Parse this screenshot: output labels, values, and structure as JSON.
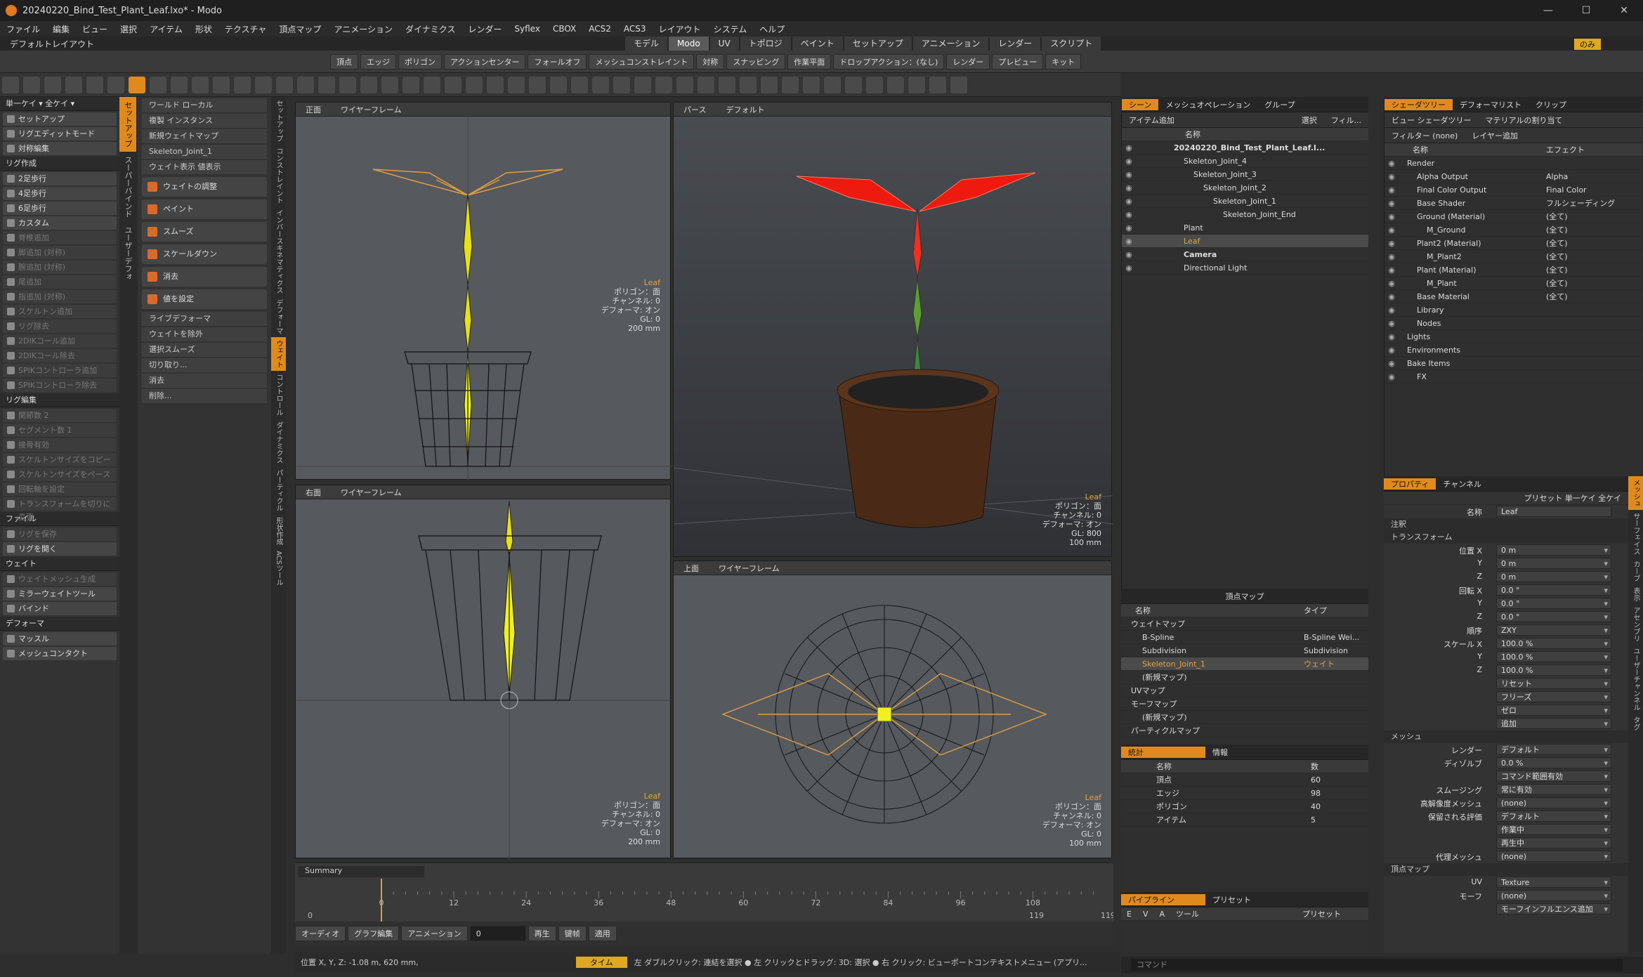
{
  "window": {
    "title": "20240220_Bind_Test_Plant_Leaf.lxo* - Modo"
  },
  "menu": [
    "ファイル",
    "編集",
    "ビュー",
    "選択",
    "アイテム",
    "形状",
    "テクスチャ",
    "頂点マップ",
    "アニメーション",
    "ダイナミクス",
    "レンダー",
    "Syflex",
    "CBOX",
    "ACS2",
    "ACS3",
    "レイアウト",
    "システム",
    "ヘルプ"
  ],
  "layout": {
    "label": "デフォルトレイアウト",
    "tabs": [
      "モデル",
      "Modo",
      "UV",
      "トポロジ",
      "ペイント",
      "セットアップ",
      "アニメーション",
      "レンダー",
      "スクリプト"
    ],
    "active": "Modo",
    "right": "のみ"
  },
  "toolbar": {
    "items": [
      "頂点",
      "エッジ",
      "ポリゴン",
      "アクションセンター",
      "フォールオフ",
      "メッシュコンストレイント",
      "対称",
      "スナッピング",
      "作業平面",
      "ドロップアクション：(なし)",
      "レンダー",
      "プレビュー",
      "キット"
    ]
  },
  "left": {
    "top": "単一ケイ ▾  全ケイ ▾",
    "items": [
      {
        "t": "b",
        "l": "セットアップ"
      },
      {
        "t": "b",
        "l": "リグエディットモード"
      },
      {
        "t": "b",
        "l": "対称編集"
      },
      {
        "t": "h",
        "l": "リグ作成"
      },
      {
        "t": "b",
        "l": "2足歩行"
      },
      {
        "t": "b",
        "l": "4足歩行"
      },
      {
        "t": "b",
        "l": "6足歩行"
      },
      {
        "t": "b",
        "l": "カスタム"
      },
      {
        "t": "d",
        "l": "脊椎追加"
      },
      {
        "t": "d",
        "l": "脚追加 (対称)"
      },
      {
        "t": "d",
        "l": "腕追加 (対称)"
      },
      {
        "t": "d",
        "l": "尾追加"
      },
      {
        "t": "d",
        "l": "指追加 (対称)"
      },
      {
        "t": "d",
        "l": "スケルトン追加"
      },
      {
        "t": "d",
        "l": "リグ除去"
      },
      {
        "t": "d",
        "l": "2DIKコール追加"
      },
      {
        "t": "d",
        "l": "2DIKコール除去"
      },
      {
        "t": "d",
        "l": "SPIKコントローラ追加"
      },
      {
        "t": "d",
        "l": "SPIKコントローラ除去"
      },
      {
        "t": "h",
        "l": "リグ編集"
      },
      {
        "t": "d",
        "l": "関節数 2"
      },
      {
        "t": "d",
        "l": "セグメント数 1"
      },
      {
        "t": "d",
        "l": "接骨有効"
      },
      {
        "t": "d",
        "l": "スケルトンサイズをコピー"
      },
      {
        "t": "d",
        "l": "スケルトンサイズをペースト"
      },
      {
        "t": "d",
        "l": "回転軸を設定"
      },
      {
        "t": "d",
        "l": "トランスフォームを切りに変更"
      },
      {
        "t": "h",
        "l": "ファイル"
      },
      {
        "t": "d",
        "l": "リグを保存"
      },
      {
        "t": "b",
        "l": "リグを開く"
      },
      {
        "t": "h",
        "l": "ウェイト"
      },
      {
        "t": "d",
        "l": "ウェイトメッシュ生成"
      },
      {
        "t": "b",
        "l": "ミラーウェイトツール"
      },
      {
        "t": "b",
        "l": "バインド"
      },
      {
        "t": "h",
        "l": "デフォーマ"
      },
      {
        "t": "b",
        "l": "マッスル"
      },
      {
        "t": "b",
        "l": "メッシュコンタクト"
      }
    ]
  },
  "vtabs1": [
    "セットアップ",
    "スーパーバインド",
    "ユーザーデフォ"
  ],
  "vtabs2": [
    "セットアップ",
    "コンストレイント",
    "インバースキネマティクス",
    "デフォーマ",
    "ウェイト",
    "コントロール",
    "ダイナミクス",
    "パーティクル",
    "形状作成",
    "ACSツール"
  ],
  "tools": {
    "items": [
      {
        "t": "s",
        "l": "ワールド  ローカル"
      },
      {
        "t": "s",
        "l": "複製  インスタンス"
      },
      {
        "t": "s",
        "l": "新規ウェイトマップ"
      },
      {
        "t": "s",
        "l": "Skeleton_Joint_1"
      },
      {
        "t": "s",
        "l": "ウェイト表示  値表示"
      },
      {
        "t": "b",
        "l": "ウェイトの調整"
      },
      {
        "t": "b",
        "l": "ペイント"
      },
      {
        "t": "b",
        "l": "スムーズ"
      },
      {
        "t": "b",
        "l": "スケールダウン"
      },
      {
        "t": "b",
        "l": "消去"
      },
      {
        "t": "b",
        "l": "値を設定"
      },
      {
        "t": "s",
        "l": "ライブデフォーマ"
      },
      {
        "t": "s",
        "l": "ウェイトを除外"
      },
      {
        "t": "s",
        "l": "選択スムーズ"
      },
      {
        "t": "s",
        "l": "切り取り..."
      },
      {
        "t": "s",
        "l": "消去"
      },
      {
        "t": "s",
        "l": "削除..."
      }
    ]
  },
  "vp1": {
    "view": "正面",
    "shade": "ワイヤーフレーム",
    "hud": [
      "Leaf",
      "ポリゴン：面",
      "チャンネル: 0",
      "デフォーマ: オン",
      "GL: 0",
      "200 mm"
    ]
  },
  "vp2": {
    "view": "パース",
    "shade": "デフォルト",
    "hud": [
      "Leaf",
      "ポリゴン：面",
      "チャンネル: 0",
      "デフォーマ: オン",
      "GL: 800",
      "100 mm"
    ]
  },
  "vp3": {
    "view": "右面",
    "shade": "ワイヤーフレーム",
    "hud": [
      "Leaf",
      "ポリゴン：面",
      "チャンネル: 0",
      "デフォーマ: オン",
      "GL: 0",
      "200 mm"
    ]
  },
  "vp4": {
    "view": "上面",
    "shade": "ワイヤーフレーム",
    "hud": [
      "Leaf",
      "ポリゴン：面",
      "チャンネル: 0",
      "デフォーマ: オン",
      "GL: 0",
      "100 mm"
    ]
  },
  "timeline": {
    "summary": "Summary",
    "ticks": [
      "0",
      "12",
      "24",
      "36",
      "48",
      "60",
      "72",
      "84",
      "96",
      "108"
    ],
    "start": "0",
    "end": "119",
    "end2": "119"
  },
  "transport": {
    "audio": "オーディオ",
    "graph": "グラフ編集",
    "anim": "アニメーション",
    "frame": "0",
    "play": "再生",
    "key": "键帧",
    "apply": "適用"
  },
  "status": {
    "pos": "位置 X, Y, Z:  -1.08 m, 620 mm,",
    "time": "タイム",
    "hint": "左 ダブルクリック: 連結を選択 ● 左 クリックとドラッグ: 3D: 選択 ● 右 クリック: ビューポートコンテキストメニュー (アプリ..."
  },
  "scene": {
    "tabs": [
      "シーン",
      "メッシュオペレーション",
      "グループ"
    ],
    "add": "アイテム追加",
    "sel": "選択",
    "filter": "フィル...",
    "col": "名称",
    "rows": [
      {
        "l": "20240220_Bind_Test_Plant_Leaf.l...",
        "d": 1,
        "b": true
      },
      {
        "l": "Skeleton_Joint_4",
        "d": 2
      },
      {
        "l": "Skeleton_Joint_3",
        "d": 3
      },
      {
        "l": "Skeleton_Joint_2",
        "d": 4
      },
      {
        "l": "Skeleton_Joint_1",
        "d": 5
      },
      {
        "l": "Skeleton_Joint_End",
        "d": 6
      },
      {
        "l": "Plant",
        "d": 2
      },
      {
        "l": "Leaf",
        "d": 2,
        "s": true
      },
      {
        "l": "Camera",
        "d": 2,
        "b": true
      },
      {
        "l": "Directional Light",
        "d": 2
      }
    ]
  },
  "vmap": {
    "title": "頂点マップ",
    "col1": "名称",
    "col2": "タイプ",
    "rows": [
      {
        "l": "ウェイトマップ",
        "t": "",
        "d": 0
      },
      {
        "l": "B-Spline",
        "t": "B-Spline Wei...",
        "d": 1
      },
      {
        "l": "Subdivision",
        "t": "Subdivision",
        "d": 1
      },
      {
        "l": "Skeleton_Joint_1",
        "t": "ウェイト",
        "d": 1,
        "s": true
      },
      {
        "l": "(新規マップ)",
        "t": "",
        "d": 1
      },
      {
        "l": "UVマップ",
        "t": "",
        "d": 0
      },
      {
        "l": "モーフマップ",
        "t": "",
        "d": 0
      },
      {
        "l": "(新規マップ)",
        "t": "",
        "d": 1
      },
      {
        "l": "パーティクルマップ",
        "t": "",
        "d": 0
      }
    ]
  },
  "stats": {
    "tabs": [
      "統計",
      "情報"
    ],
    "col1": "名称",
    "col2": "数",
    "rows": [
      {
        "l": "頂点",
        "n": "60"
      },
      {
        "l": "エッジ",
        "n": "98"
      },
      {
        "l": "ポリゴン",
        "n": "40"
      },
      {
        "l": "アイテム",
        "n": "5"
      }
    ]
  },
  "pipeline": {
    "tabs": [
      "パイプライン",
      "プリセット"
    ],
    "cols": [
      "E",
      "V",
      "A",
      "ツール",
      "プリセット"
    ]
  },
  "shader": {
    "tabs": [
      "シェーダツリー",
      "デフォーマリスト",
      "クリップ"
    ],
    "view": "ビュー  シェーダツリー",
    "assign": "マテリアルの割り当て",
    "filter": "フィルター  (none)",
    "layer": "レイヤー追加",
    "col1": "名称",
    "col2": "エフェクト",
    "rows": [
      {
        "l": "Render",
        "e": "",
        "d": 0
      },
      {
        "l": "Alpha Output",
        "e": "Alpha",
        "d": 1
      },
      {
        "l": "Final Color Output",
        "e": "Final Color",
        "d": 1
      },
      {
        "l": "Base Shader",
        "e": "フルシェーディング",
        "d": 1
      },
      {
        "l": "Ground (Material)",
        "e": "(全て)",
        "d": 1
      },
      {
        "l": "M_Ground",
        "e": "(全て)",
        "d": 2
      },
      {
        "l": "Plant2 (Material)",
        "e": "(全て)",
        "d": 1
      },
      {
        "l": "M_Plant2",
        "e": "(全て)",
        "d": 2
      },
      {
        "l": "Plant (Material)",
        "e": "(全て)",
        "d": 1
      },
      {
        "l": "M_Plant",
        "e": "(全て)",
        "d": 2
      },
      {
        "l": "Base Material",
        "e": "(全て)",
        "d": 1
      },
      {
        "l": "Library",
        "e": "",
        "d": 1
      },
      {
        "l": "Nodes",
        "e": "",
        "d": 1
      },
      {
        "l": "Lights",
        "e": "",
        "d": 0
      },
      {
        "l": "Environments",
        "e": "",
        "d": 0
      },
      {
        "l": "Bake Items",
        "e": "",
        "d": 0
      },
      {
        "l": "FX",
        "e": "",
        "d": 1
      }
    ]
  },
  "props": {
    "tabs": [
      "プロパティ",
      "チャンネル"
    ],
    "preset": "プリセット  単一ケイ  全ケイ",
    "name_label": "名称",
    "name": "Leaf",
    "rows": [
      {
        "k": "sec",
        "l": "注釈"
      },
      {
        "k": "sec",
        "l": "トランスフォーム"
      },
      {
        "k": "p",
        "l": "位置 X",
        "v": "0 m"
      },
      {
        "k": "p",
        "l": "Y",
        "v": "0 m"
      },
      {
        "k": "p",
        "l": "Z",
        "v": "0 m"
      },
      {
        "k": "p",
        "l": "回転 X",
        "v": "0.0 °"
      },
      {
        "k": "p",
        "l": "Y",
        "v": "0.0 °"
      },
      {
        "k": "p",
        "l": "Z",
        "v": "0.0 °"
      },
      {
        "k": "p",
        "l": "順序",
        "v": "ZXY"
      },
      {
        "k": "p",
        "l": "スケール X",
        "v": "100.0 %"
      },
      {
        "k": "p",
        "l": "Y",
        "v": "100.0 %"
      },
      {
        "k": "p",
        "l": "Z",
        "v": "100.0 %"
      },
      {
        "k": "p",
        "l": "",
        "v": "リセット"
      },
      {
        "k": "p",
        "l": "",
        "v": "フリーズ"
      },
      {
        "k": "p",
        "l": "",
        "v": "ゼロ"
      },
      {
        "k": "p",
        "l": "",
        "v": "追加"
      },
      {
        "k": "sec",
        "l": "メッシュ"
      },
      {
        "k": "p",
        "l": "レンダー",
        "v": "デフォルト"
      },
      {
        "k": "p",
        "l": "ディゾルブ",
        "v": "0.0 %"
      },
      {
        "k": "p",
        "l": "",
        "v": "コマンド範囲有効"
      },
      {
        "k": "p",
        "l": "スムージング",
        "v": "常に有効"
      },
      {
        "k": "p",
        "l": "高解像度メッシュ",
        "v": "(none)"
      },
      {
        "k": "p",
        "l": "保留される評価",
        "v": "デフォルト"
      },
      {
        "k": "p",
        "l": "",
        "v": "作業中"
      },
      {
        "k": "p",
        "l": "",
        "v": "再生中"
      },
      {
        "k": "p",
        "l": "代理メッシュ",
        "v": "(none)"
      },
      {
        "k": "sec",
        "l": "頂点マップ"
      },
      {
        "k": "p",
        "l": "UV",
        "v": "Texture"
      },
      {
        "k": "p",
        "l": "モーフ",
        "v": "(none)"
      },
      {
        "k": "p",
        "l": "",
        "v": "モーフインフルエンス追加"
      }
    ]
  },
  "rvtabs": [
    "メッシュ",
    "サーフェイス",
    "カーブ",
    "表示",
    "アセンブリ",
    "ユーザーチャンネル",
    "タグ"
  ],
  "cmd": "コマンド"
}
